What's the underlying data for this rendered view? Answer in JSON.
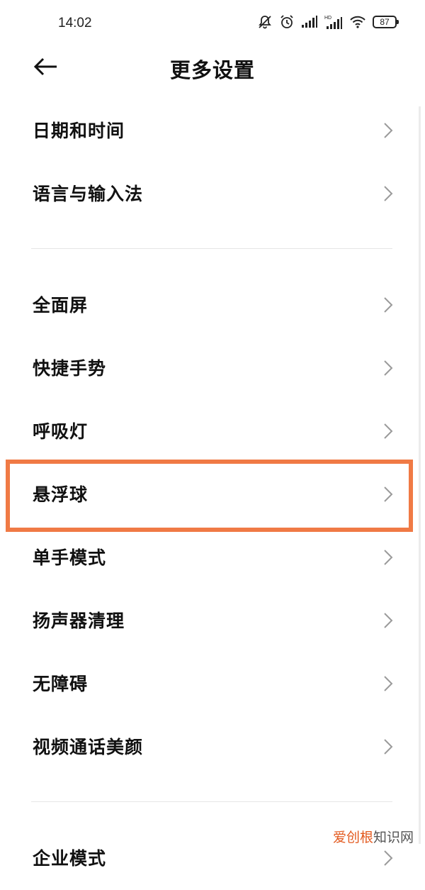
{
  "status_bar": {
    "time": "14:02",
    "battery_level": "87",
    "icons": [
      "bell-muted-icon",
      "alarm-icon",
      "signal-icon",
      "hd-signal-icon",
      "wifi-icon",
      "battery-icon"
    ]
  },
  "header": {
    "title": "更多设置",
    "back_icon": "arrow-left-icon"
  },
  "groups": [
    {
      "items": [
        "日期和时间",
        "语言与输入法"
      ]
    },
    {
      "items": [
        "全面屏",
        "快捷手势",
        "呼吸灯",
        "悬浮球",
        "单手模式",
        "扬声器清理",
        "无障碍",
        "视频通话美颜"
      ]
    },
    {
      "items": [
        "企业模式"
      ]
    }
  ],
  "highlighted_item": "悬浮球",
  "colors": {
    "highlight": "#f07a45",
    "text": "#111111",
    "chevron": "#9a9a9a",
    "divider": "#e6e6e6"
  },
  "watermark": {
    "brand": "爱创根",
    "suffix": "知识网"
  }
}
